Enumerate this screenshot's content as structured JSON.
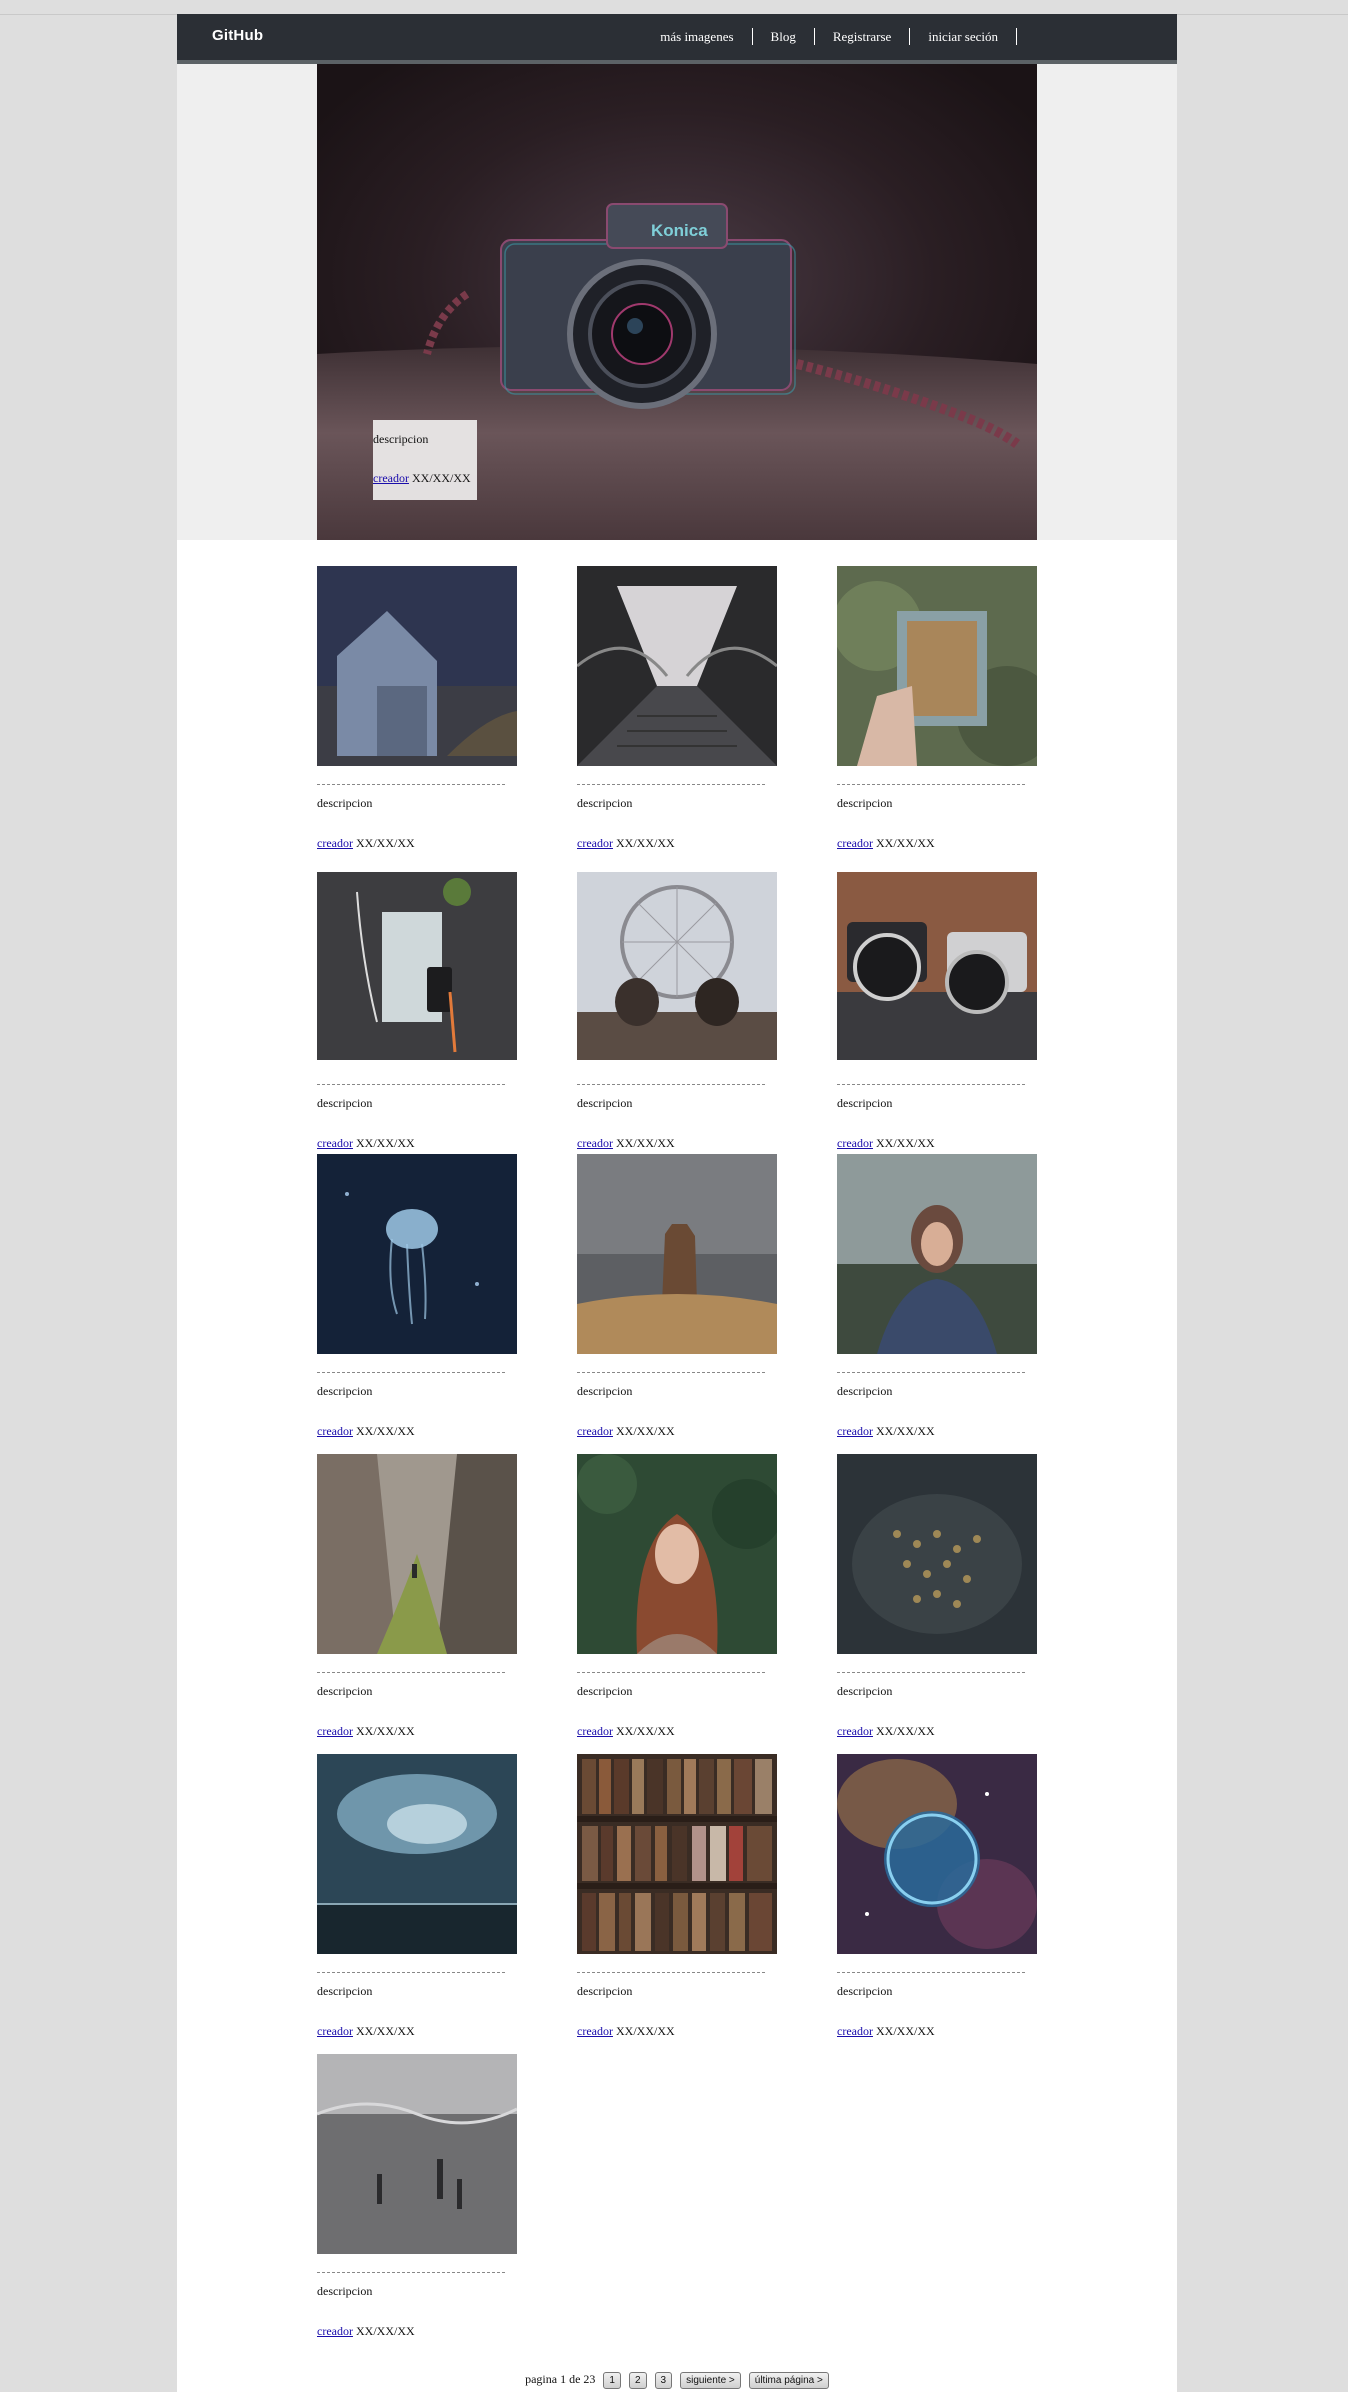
{
  "navbar": {
    "brand": "GitHub",
    "links": [
      "más imagenes",
      "Blog",
      "Registrarse",
      "iniciar seción"
    ]
  },
  "hero": {
    "description": "descripcion",
    "creator": "creador",
    "date": "XX/XX/XX",
    "camera_brand": "Konica"
  },
  "gallery": {
    "items": [
      {
        "description": "descripcion",
        "creator": "creador",
        "date": "XX/XX/XX"
      },
      {
        "description": "descripcion",
        "creator": "creador",
        "date": "XX/XX/XX"
      },
      {
        "description": "descripcion",
        "creator": "creador",
        "date": "XX/XX/XX"
      },
      {
        "description": "descripcion",
        "creator": "creador",
        "date": "XX/XX/XX"
      },
      {
        "description": "descripcion",
        "creator": "creador",
        "date": "XX/XX/XX"
      },
      {
        "description": "descripcion",
        "creator": "creador",
        "date": "XX/XX/XX"
      },
      {
        "description": "descripcion",
        "creator": "creador",
        "date": "XX/XX/XX"
      },
      {
        "description": "descripcion",
        "creator": "creador",
        "date": "XX/XX/XX"
      },
      {
        "description": "descripcion",
        "creator": "creador",
        "date": "XX/XX/XX"
      },
      {
        "description": "descripcion",
        "creator": "creador",
        "date": "XX/XX/XX"
      },
      {
        "description": "descripcion",
        "creator": "creador",
        "date": "XX/XX/XX"
      },
      {
        "description": "descripcion",
        "creator": "creador",
        "date": "XX/XX/XX"
      },
      {
        "description": "descripcion",
        "creator": "creador",
        "date": "XX/XX/XX"
      },
      {
        "description": "descripcion",
        "creator": "creador",
        "date": "XX/XX/XX"
      },
      {
        "description": "descripcion",
        "creator": "creador",
        "date": "XX/XX/XX"
      },
      {
        "description": "descripcion",
        "creator": "creador",
        "date": "XX/XX/XX"
      }
    ]
  },
  "pagination": {
    "status": "pagina 1 de 23",
    "page_buttons": [
      "1",
      "2",
      "3"
    ],
    "next_label": "siguiente >",
    "last_label": "última página >"
  }
}
